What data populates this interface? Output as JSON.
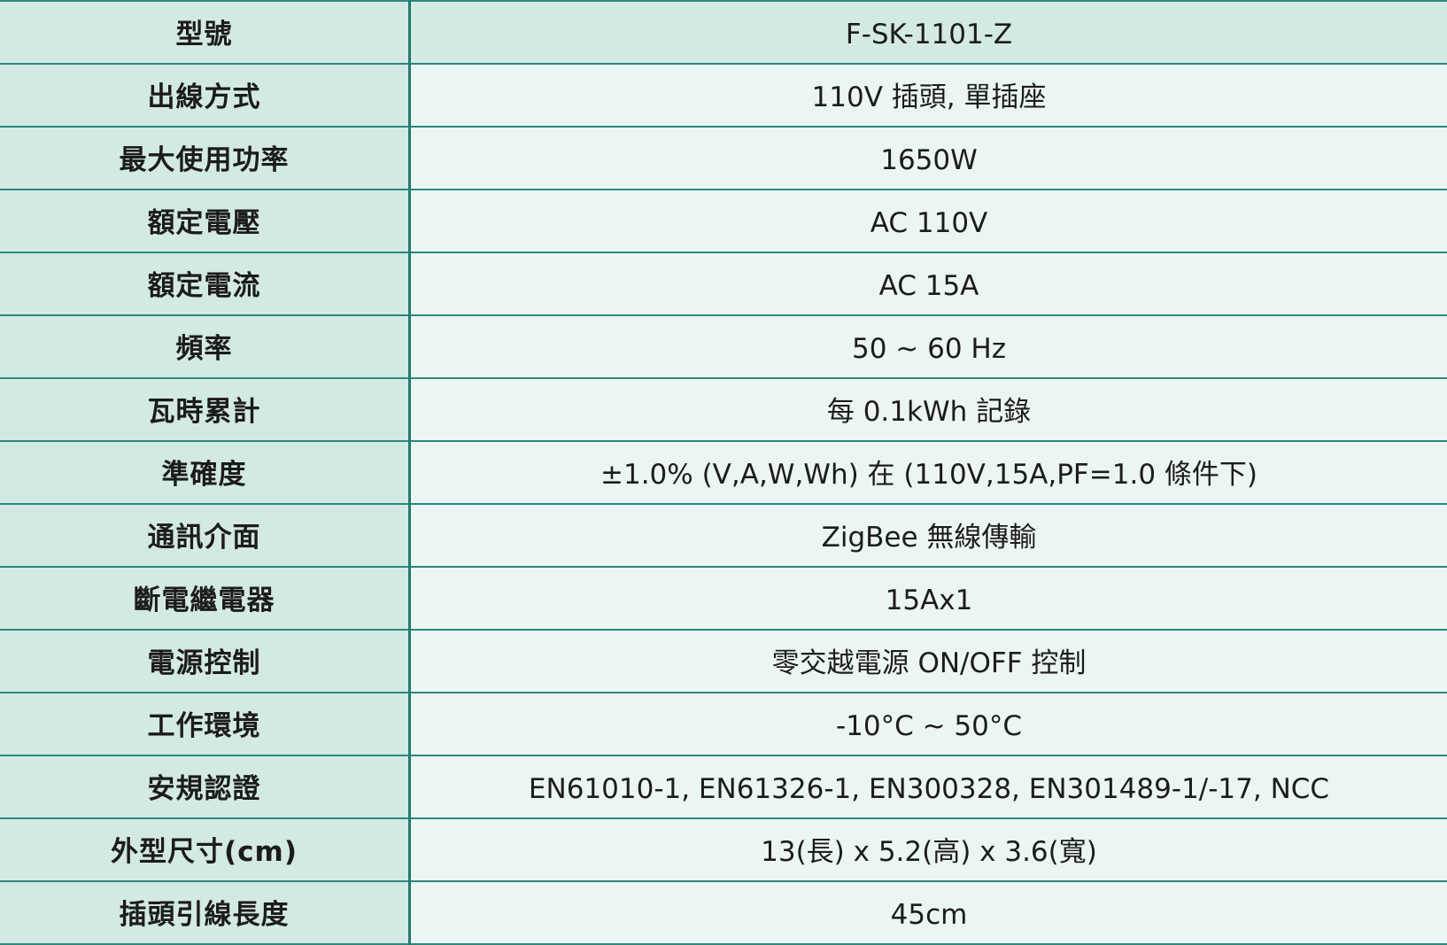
{
  "spec_rows": [
    {
      "label": "型號",
      "value": "F-SK-1101-Z"
    },
    {
      "label": "出線方式",
      "value": "110V 插頭, 單插座"
    },
    {
      "label": "最大使用功率",
      "value": "1650W"
    },
    {
      "label": "額定電壓",
      "value": "AC 110V"
    },
    {
      "label": "額定電流",
      "value": "AC 15A"
    },
    {
      "label": "頻率",
      "value": "50 ~ 60 Hz"
    },
    {
      "label": "瓦時累計",
      "value": "每 0.1kWh 記錄"
    },
    {
      "label": "準確度",
      "value": "±1.0% (V,A,W,Wh) 在 (110V,15A,PF=1.0 條件下)"
    },
    {
      "label": "通訊介面",
      "value": "ZigBee 無線傳輸"
    },
    {
      "label": "斷電繼電器",
      "value": "15Ax1"
    },
    {
      "label": "電源控制",
      "value": "零交越電源 ON/OFF 控制"
    },
    {
      "label": "工作環境",
      "value": "-10°C ~ 50°C"
    },
    {
      "label": "安規認證",
      "value": "EN61010-1, EN61326-1, EN300328, EN301489-1/-17, NCC"
    },
    {
      "label": "外型尺寸(cm)",
      "value": "13(長) x 5.2(高) x 3.6(寬)"
    },
    {
      "label": "插頭引線長度",
      "value": "45cm"
    }
  ]
}
